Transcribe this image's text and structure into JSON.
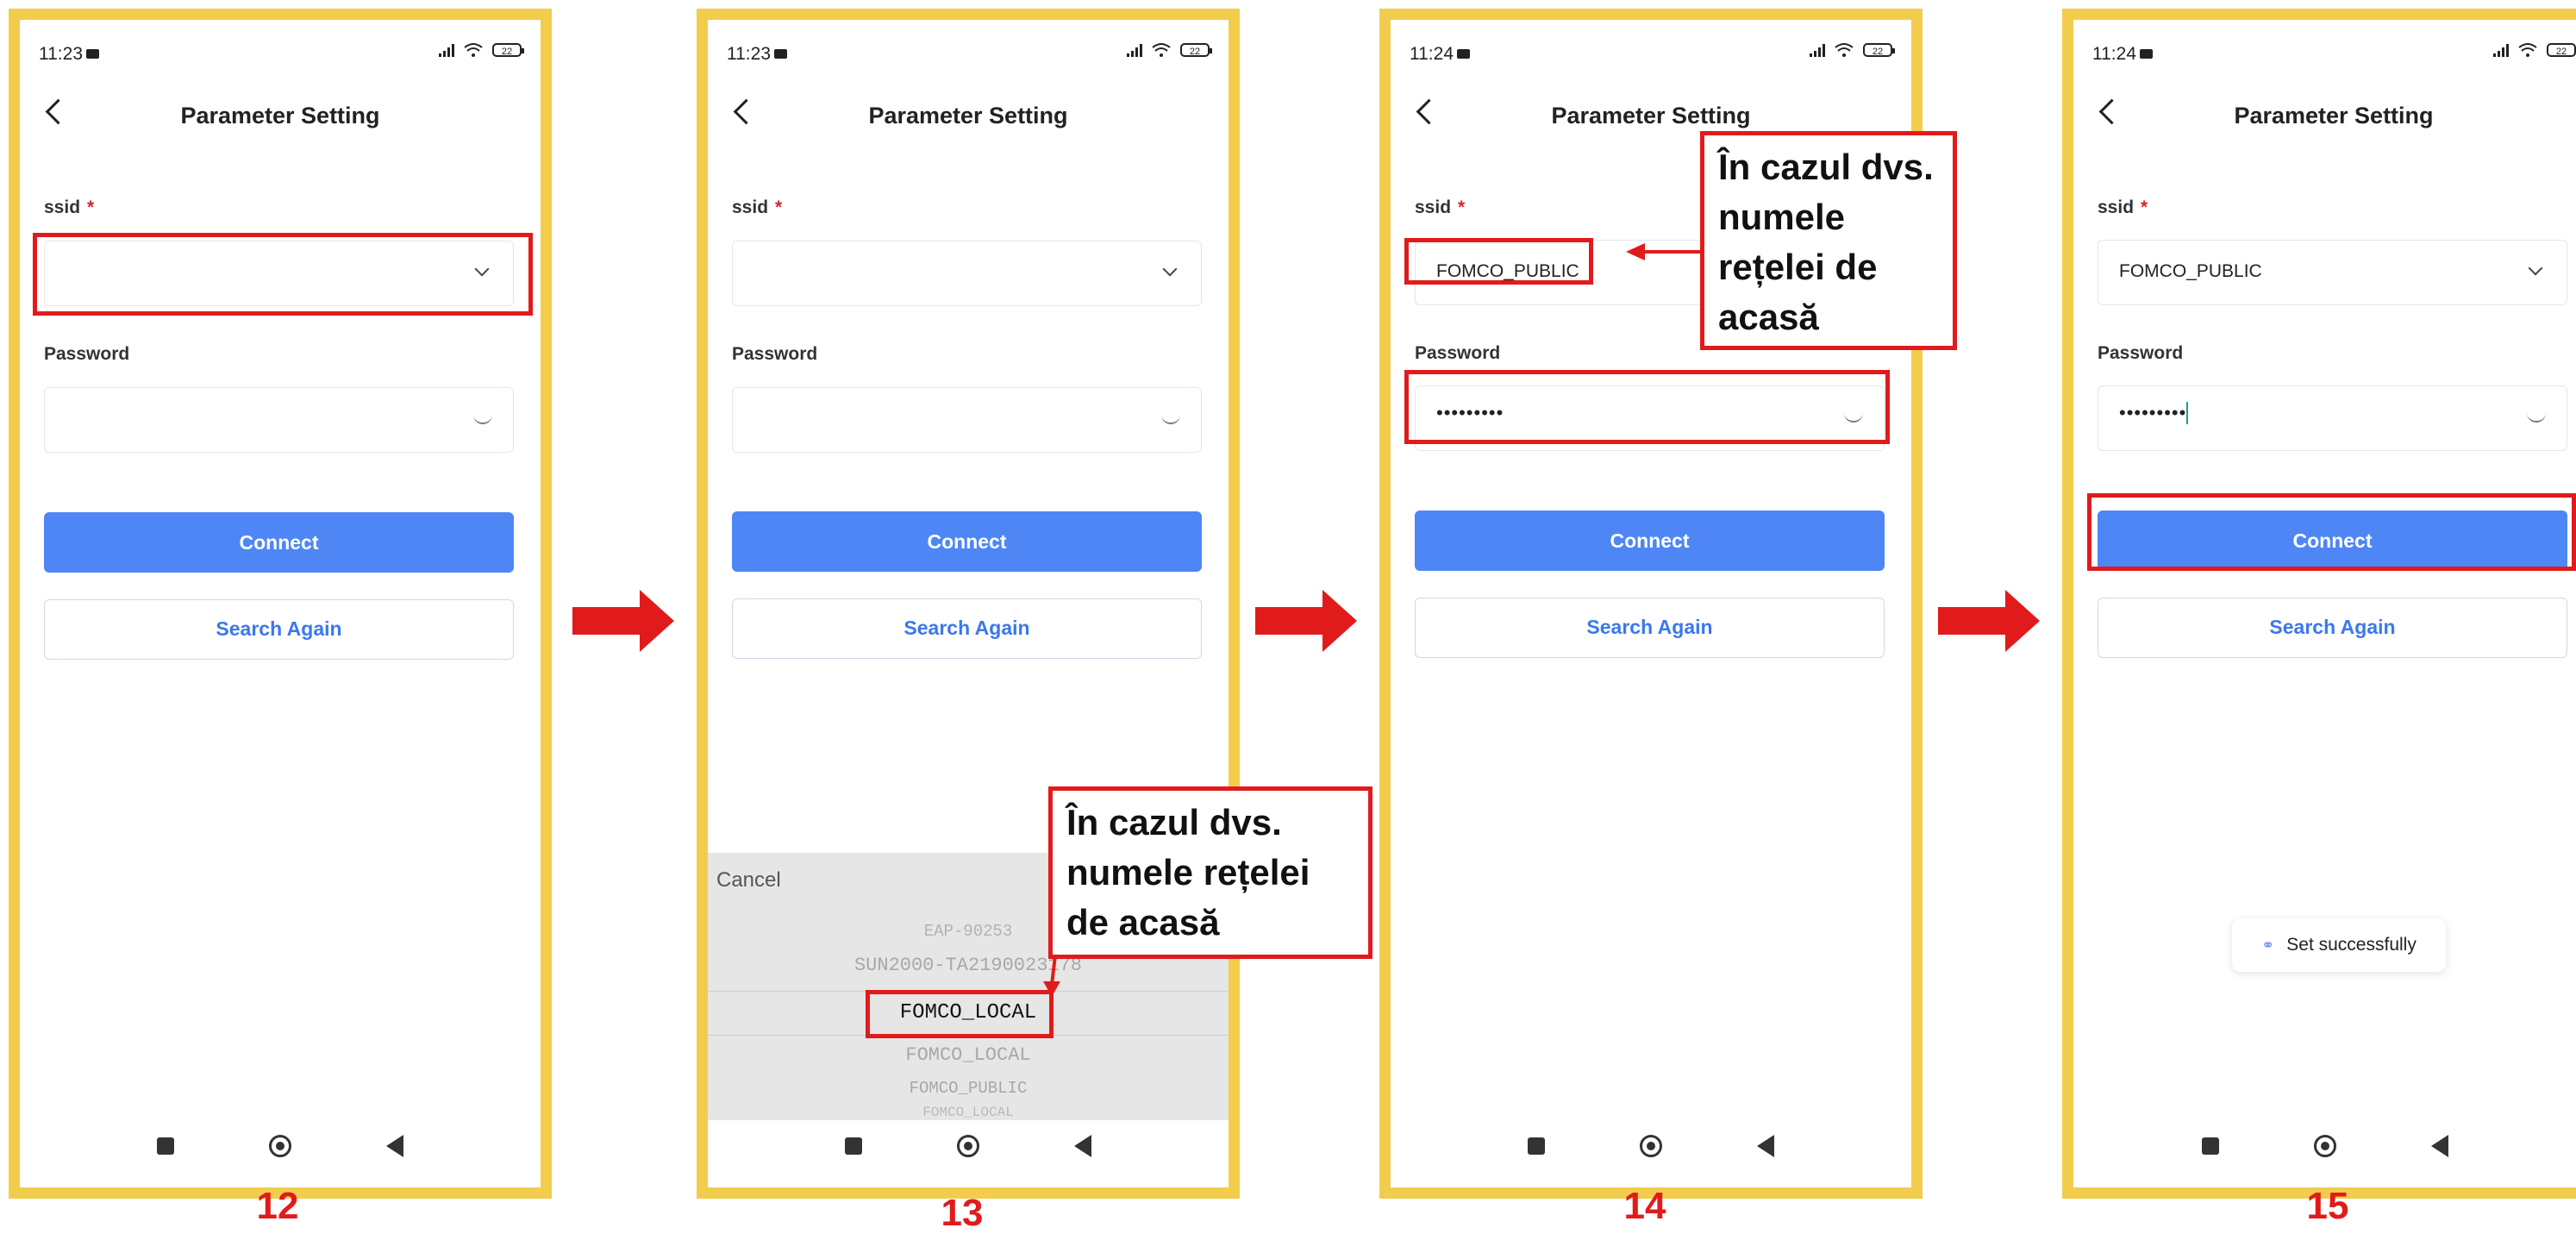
{
  "common": {
    "title": "Parameter Setting",
    "ssid_label": "ssid",
    "required_mark": "*",
    "password_label": "Password",
    "connect_label": "Connect",
    "search_again_label": "Search Again",
    "battery": "22"
  },
  "screens": [
    {
      "step": "12",
      "time": "11:23",
      "ssid_value": "",
      "password_value": ""
    },
    {
      "step": "13",
      "time": "11:23",
      "ssid_value": "",
      "password_value": ""
    },
    {
      "step": "14",
      "time": "11:24",
      "ssid_value": "FOMCO_PUBLIC",
      "password_value": "•••••••••"
    },
    {
      "step": "15",
      "time": "11:24",
      "ssid_value": "FOMCO_PUBLIC",
      "password_value": "•••••••••"
    }
  ],
  "picker": {
    "cancel": "Cancel",
    "options": [
      "EAP-90253",
      "SUN2000-TA2190023178",
      "FOMCO_LOCAL",
      "FOMCO_LOCAL",
      "FOMCO_PUBLIC",
      "FOMCO_LOCAL"
    ]
  },
  "callouts": {
    "screen13": [
      "În cazul dvs.",
      "numele rețelei",
      "de acasă"
    ],
    "screen14": [
      "În cazul dvs.",
      "numele",
      "rețelei de",
      "acasă"
    ]
  },
  "toast": {
    "message": "Set successfully",
    "icon": "link-icon"
  },
  "colors": {
    "frame": "#f2cc4d",
    "highlight": "#e11b1b",
    "primary": "#4e87f5"
  }
}
